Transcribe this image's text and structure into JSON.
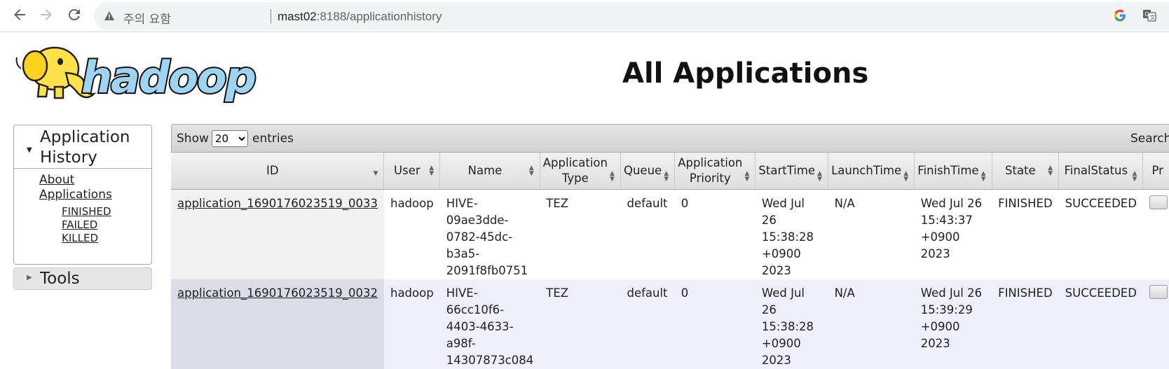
{
  "browser": {
    "security_warning": "주의 요함",
    "url_host": "mast02",
    "url_path": ":8188/applicationhistory"
  },
  "page": {
    "logo_alt": "hadoop",
    "title": "All Applications"
  },
  "sidebar": {
    "section_title": "Application History",
    "links": [
      "About",
      "Applications"
    ],
    "sublinks": [
      "FINISHED",
      "FAILED",
      "KILLED"
    ],
    "tools_title": "Tools"
  },
  "toolbar": {
    "show_label": "Show",
    "page_size": "20",
    "page_size_options": [
      "20"
    ],
    "entries_label": "entries",
    "search_label": "Search:"
  },
  "table": {
    "headers": [
      "ID",
      "User",
      "Name",
      "Application Type",
      "Queue",
      "Application Priority",
      "StartTime",
      "LaunchTime",
      "FinishTime",
      "State",
      "FinalStatus",
      "Pr"
    ],
    "rows": [
      {
        "id": "application_1690176023519_0033",
        "user": "hadoop",
        "name": "HIVE-\n09ae3dde-\n0782-45dc-\nb3a5-\n2091f8fb0751",
        "type": "TEZ",
        "queue": "default",
        "priority": "0",
        "start": "Wed Jul\n26\n15:38:28\n+0900\n2023",
        "launch": "N/A",
        "finish": "Wed Jul 26\n15:43:37\n+0900\n2023",
        "state": "FINISHED",
        "final_status": "SUCCEEDED"
      },
      {
        "id": "application_1690176023519_0032",
        "user": "hadoop",
        "name": "HIVE-\n66cc10f6-\n4403-4633-\na98f-\n14307873c084",
        "type": "TEZ",
        "queue": "default",
        "priority": "0",
        "start": "Wed Jul\n26\n15:38:28\n+0900\n2023",
        "launch": "N/A",
        "finish": "Wed Jul 26\n15:39:29\n+0900\n2023",
        "state": "FINISHED",
        "final_status": "SUCCEEDED"
      }
    ]
  }
}
